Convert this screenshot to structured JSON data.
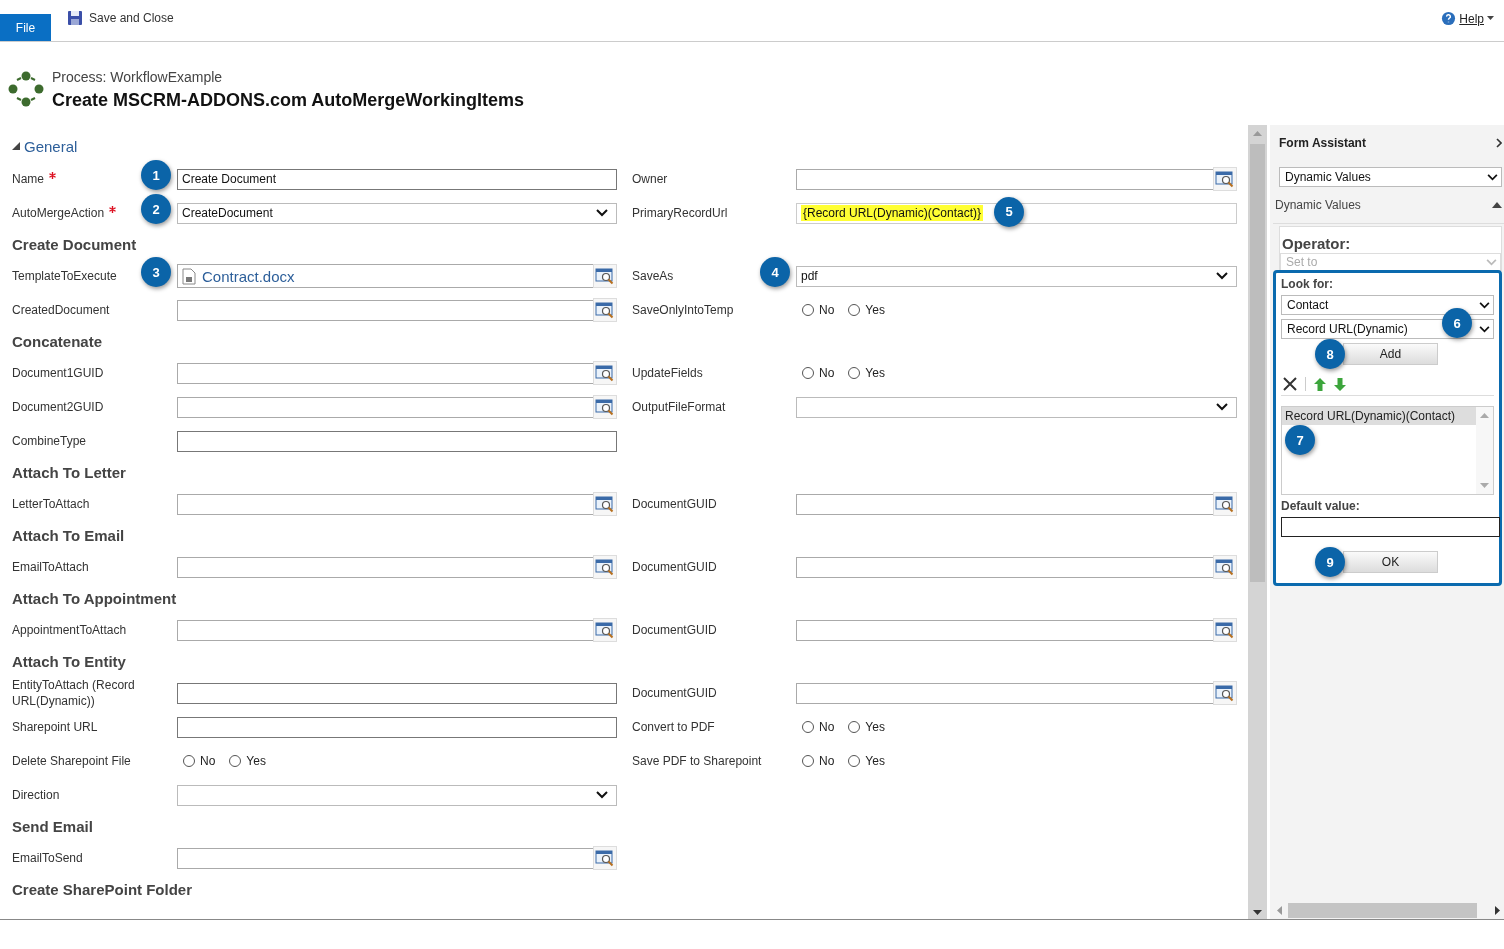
{
  "toolbar": {
    "file_tab": "File",
    "save_button": "Save and Close",
    "help": "Help"
  },
  "header": {
    "subtitle": "Process: WorkflowExample",
    "title": "Create MSCRM-ADDONS.com AutoMergeWorkingItems"
  },
  "general": {
    "label": "General",
    "expanded": true
  },
  "rows": [
    {
      "kind": "fields",
      "left": {
        "label": "Name",
        "required": true,
        "kind": "text",
        "value": "Create Document",
        "badge": "1"
      },
      "right": {
        "label": "Owner",
        "required": false,
        "kind": "lookup"
      }
    },
    {
      "kind": "fields",
      "left": {
        "label": "AutoMergeAction",
        "required": true,
        "kind": "select",
        "value": "CreateDocument",
        "badge": "2"
      },
      "right": {
        "label": "PrimaryRecordUrl",
        "required": false,
        "kind": "token",
        "value": "{Record URL(Dynamic)(Contact)}",
        "badge": "5"
      }
    },
    {
      "kind": "section",
      "title": "Create Document"
    },
    {
      "kind": "fields",
      "left": {
        "label": "TemplateToExecute",
        "required": false,
        "kind": "file",
        "value": "Contract.docx",
        "badge": "3"
      },
      "right": {
        "label": "SaveAs",
        "required": false,
        "kind": "select",
        "value": "pdf",
        "badge": "4"
      }
    },
    {
      "kind": "fields",
      "left": {
        "label": "CreatedDocument",
        "required": false,
        "kind": "lookup"
      },
      "right": {
        "label": "SaveOnlyIntoTemp",
        "required": false,
        "kind": "radio",
        "options": [
          {
            "label": "No",
            "selected": false
          },
          {
            "label": "Yes",
            "selected": false
          }
        ]
      }
    },
    {
      "kind": "section",
      "title": "Concatenate"
    },
    {
      "kind": "fields",
      "left": {
        "label": "Document1GUID",
        "required": false,
        "kind": "lookup"
      },
      "right": {
        "label": "UpdateFields",
        "required": false,
        "kind": "radio",
        "options": [
          {
            "label": "No",
            "selected": false
          },
          {
            "label": "Yes",
            "selected": false
          }
        ]
      }
    },
    {
      "kind": "fields",
      "left": {
        "label": "Document2GUID",
        "required": false,
        "kind": "lookup"
      },
      "right": {
        "label": "OutputFileFormat",
        "required": false,
        "kind": "select"
      }
    },
    {
      "kind": "fields",
      "left": {
        "label": "CombineType",
        "required": false,
        "kind": "text"
      }
    },
    {
      "kind": "section",
      "title": "Attach To Letter"
    },
    {
      "kind": "fields",
      "left": {
        "label": "LetterToAttach",
        "required": false,
        "kind": "lookup"
      },
      "right": {
        "label": "DocumentGUID",
        "required": false,
        "kind": "lookup"
      }
    },
    {
      "kind": "section",
      "title": "Attach To Email"
    },
    {
      "kind": "fields",
      "left": {
        "label": "EmailToAttach",
        "required": false,
        "kind": "lookup"
      },
      "right": {
        "label": "DocumentGUID",
        "required": false,
        "kind": "lookup"
      }
    },
    {
      "kind": "section",
      "title": "Attach To Appointment"
    },
    {
      "kind": "fields",
      "left": {
        "label": "AppointmentToAttach",
        "required": false,
        "kind": "lookup"
      },
      "right": {
        "label": "DocumentGUID",
        "required": false,
        "kind": "lookup"
      }
    },
    {
      "kind": "section",
      "title": "Attach To Entity"
    },
    {
      "kind": "fields",
      "left": {
        "label": "EntityToAttach (Record URL(Dynamic))",
        "required": false,
        "kind": "text"
      },
      "right": {
        "label": "DocumentGUID",
        "required": false,
        "kind": "lookup"
      }
    },
    {
      "kind": "fields",
      "left": {
        "label": "Sharepoint URL",
        "required": false,
        "kind": "text"
      },
      "right": {
        "label": "Convert to PDF",
        "required": false,
        "kind": "radio",
        "options": [
          {
            "label": "No",
            "selected": false
          },
          {
            "label": "Yes",
            "selected": false
          }
        ]
      }
    },
    {
      "kind": "fields",
      "left": {
        "label": "Delete Sharepoint File",
        "required": false,
        "kind": "radio",
        "options": [
          {
            "label": "No",
            "selected": false
          },
          {
            "label": "Yes",
            "selected": false
          }
        ]
      },
      "right": {
        "label": "Save PDF to Sharepoint",
        "required": false,
        "kind": "radio",
        "options": [
          {
            "label": "No",
            "selected": false
          },
          {
            "label": "Yes",
            "selected": false
          }
        ]
      }
    },
    {
      "kind": "fields",
      "left": {
        "label": "Direction",
        "required": false,
        "kind": "select"
      }
    },
    {
      "kind": "section",
      "title": "Send Email"
    },
    {
      "kind": "fields",
      "left": {
        "label": "EmailToSend",
        "required": false,
        "kind": "lookup"
      }
    },
    {
      "kind": "section",
      "title": "Create SharePoint Folder"
    }
  ],
  "form_assistant": {
    "title": "Form Assistant",
    "source_select": "Dynamic Values",
    "section_label": "Dynamic Values",
    "expanded": true,
    "operator_label": "Operator:",
    "operator_select": "Set to",
    "look_for_label": "Look for:",
    "entity_select": "Contact",
    "attribute_select": "Record URL(Dynamic)",
    "attribute_badge": "6",
    "add_button": "Add",
    "add_badge": "8",
    "list_items": [
      {
        "label": "Record URL(Dynamic)(Contact)",
        "selected": true
      }
    ],
    "list_badge": "7",
    "default_label": "Default value:",
    "ok_button": "OK",
    "ok_badge": "9"
  }
}
